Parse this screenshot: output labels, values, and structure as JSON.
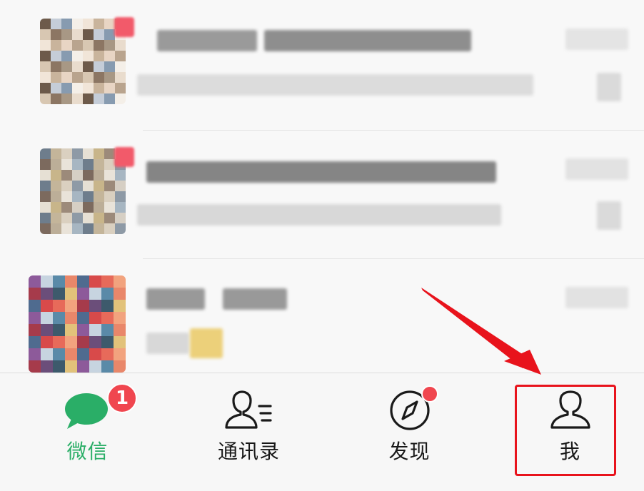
{
  "tabbar": {
    "tabs": [
      {
        "label": "微信",
        "icon": "chat-bubble-icon",
        "badge": "1",
        "active": true
      },
      {
        "label": "通讯录",
        "icon": "contacts-icon",
        "active": false
      },
      {
        "label": "发现",
        "icon": "compass-icon",
        "has_dot": true,
        "active": false
      },
      {
        "label": "我",
        "icon": "person-icon",
        "active": false
      }
    ]
  },
  "colors": {
    "active": "#2aae67",
    "badge": "#f0464f",
    "annotation": "#e8131c"
  }
}
